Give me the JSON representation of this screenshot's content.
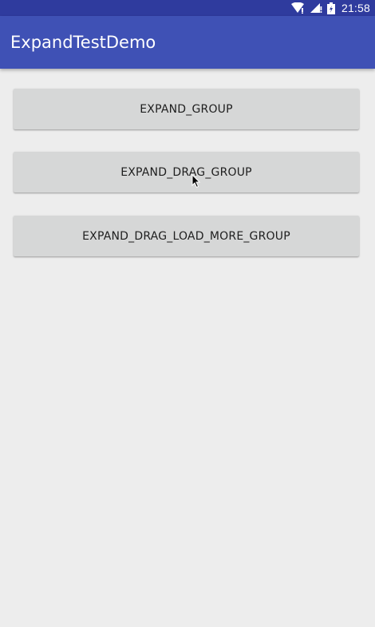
{
  "status_bar": {
    "time": "21:58",
    "icons": [
      "wifi-icon",
      "signal-icon",
      "battery-icon"
    ]
  },
  "app_bar": {
    "title": "ExpandTestDemo"
  },
  "buttons": [
    {
      "label": "EXPAND_GROUP"
    },
    {
      "label": "EXPAND_DRAG_GROUP"
    },
    {
      "label": "EXPAND_DRAG_LOAD_MORE_GROUP"
    }
  ],
  "colors": {
    "status_bar": "#2f3b9e",
    "app_bar": "#3f51b5",
    "background": "#ededed",
    "button": "#d6d7d7",
    "button_text": "#1e1e1e"
  }
}
